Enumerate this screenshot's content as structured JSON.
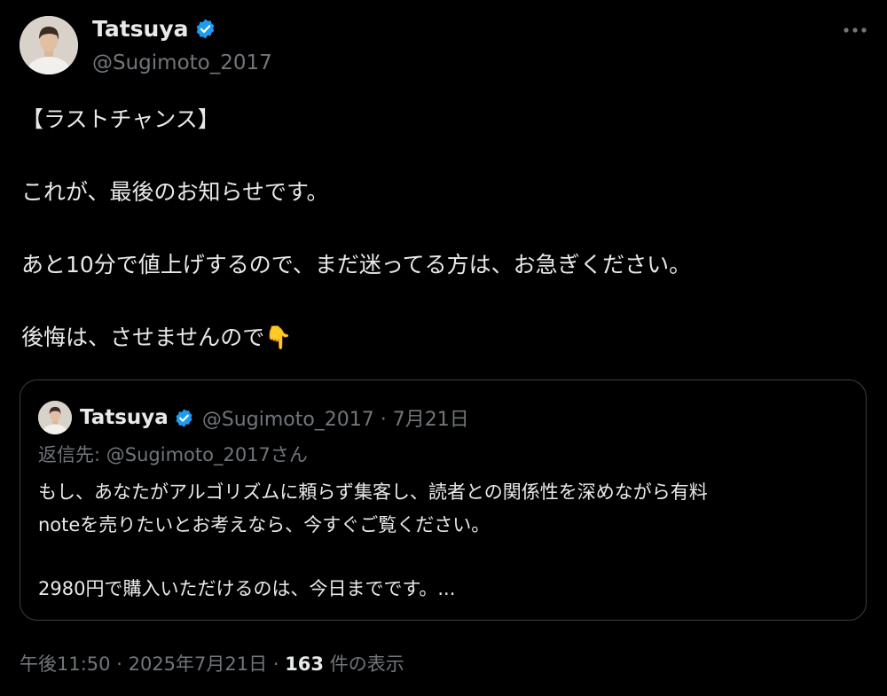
{
  "author": {
    "name": "Tatsuya",
    "handle": "@Sugimoto_2017",
    "verified_color": "#1d9bf0"
  },
  "menu_icon": "more-dots-icon",
  "tweet": {
    "line1": "【ラストチャンス】",
    "line2": "これが、最後のお知らせです。",
    "line3": "あと10分で値上げするので、まだ迷ってる方は、お急ぎください。",
    "line4": "後悔は、させませんので",
    "emoji": "👇"
  },
  "quote": {
    "name": "Tatsuya",
    "handle": "@Sugimoto_2017",
    "separator": "·",
    "date": "7月21日",
    "reply_prefix": "返信先: ",
    "reply_handle": "@Sugimoto_2017さん",
    "body_line1": "もし、あなたがアルゴリズムに頼らず集客し、読者との関係性を深めながら有料",
    "body_line2": "noteを売りたいとお考えなら、今すぐご覧ください。",
    "body_line3": "2980円で購入いただけるのは、今日までです。..."
  },
  "footer": {
    "time": "午後11:50",
    "separator": "·",
    "date": "2025年7月21日",
    "views_count": "163",
    "views_label": "件の表示"
  }
}
